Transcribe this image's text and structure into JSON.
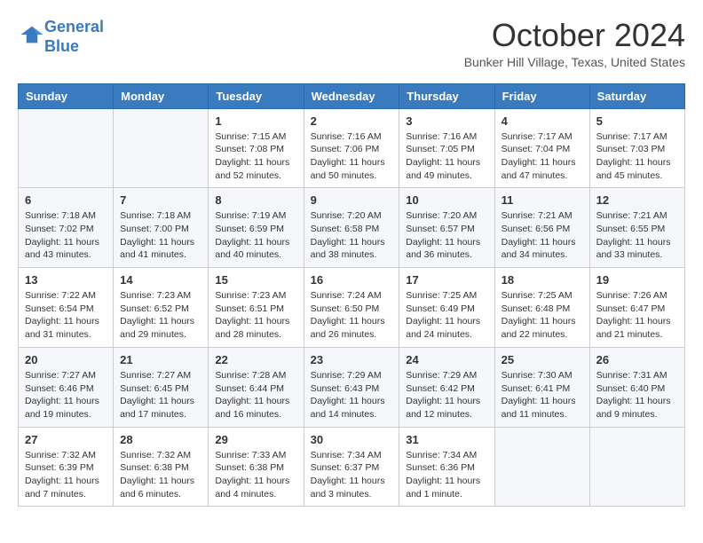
{
  "header": {
    "logo_line1": "General",
    "logo_line2": "Blue",
    "month_title": "October 2024",
    "location": "Bunker Hill Village, Texas, United States"
  },
  "weekdays": [
    "Sunday",
    "Monday",
    "Tuesday",
    "Wednesday",
    "Thursday",
    "Friday",
    "Saturday"
  ],
  "weeks": [
    [
      {
        "day": "",
        "info": ""
      },
      {
        "day": "",
        "info": ""
      },
      {
        "day": "1",
        "info": "Sunrise: 7:15 AM\nSunset: 7:08 PM\nDaylight: 11 hours and 52 minutes."
      },
      {
        "day": "2",
        "info": "Sunrise: 7:16 AM\nSunset: 7:06 PM\nDaylight: 11 hours and 50 minutes."
      },
      {
        "day": "3",
        "info": "Sunrise: 7:16 AM\nSunset: 7:05 PM\nDaylight: 11 hours and 49 minutes."
      },
      {
        "day": "4",
        "info": "Sunrise: 7:17 AM\nSunset: 7:04 PM\nDaylight: 11 hours and 47 minutes."
      },
      {
        "day": "5",
        "info": "Sunrise: 7:17 AM\nSunset: 7:03 PM\nDaylight: 11 hours and 45 minutes."
      }
    ],
    [
      {
        "day": "6",
        "info": "Sunrise: 7:18 AM\nSunset: 7:02 PM\nDaylight: 11 hours and 43 minutes."
      },
      {
        "day": "7",
        "info": "Sunrise: 7:18 AM\nSunset: 7:00 PM\nDaylight: 11 hours and 41 minutes."
      },
      {
        "day": "8",
        "info": "Sunrise: 7:19 AM\nSunset: 6:59 PM\nDaylight: 11 hours and 40 minutes."
      },
      {
        "day": "9",
        "info": "Sunrise: 7:20 AM\nSunset: 6:58 PM\nDaylight: 11 hours and 38 minutes."
      },
      {
        "day": "10",
        "info": "Sunrise: 7:20 AM\nSunset: 6:57 PM\nDaylight: 11 hours and 36 minutes."
      },
      {
        "day": "11",
        "info": "Sunrise: 7:21 AM\nSunset: 6:56 PM\nDaylight: 11 hours and 34 minutes."
      },
      {
        "day": "12",
        "info": "Sunrise: 7:21 AM\nSunset: 6:55 PM\nDaylight: 11 hours and 33 minutes."
      }
    ],
    [
      {
        "day": "13",
        "info": "Sunrise: 7:22 AM\nSunset: 6:54 PM\nDaylight: 11 hours and 31 minutes."
      },
      {
        "day": "14",
        "info": "Sunrise: 7:23 AM\nSunset: 6:52 PM\nDaylight: 11 hours and 29 minutes."
      },
      {
        "day": "15",
        "info": "Sunrise: 7:23 AM\nSunset: 6:51 PM\nDaylight: 11 hours and 28 minutes."
      },
      {
        "day": "16",
        "info": "Sunrise: 7:24 AM\nSunset: 6:50 PM\nDaylight: 11 hours and 26 minutes."
      },
      {
        "day": "17",
        "info": "Sunrise: 7:25 AM\nSunset: 6:49 PM\nDaylight: 11 hours and 24 minutes."
      },
      {
        "day": "18",
        "info": "Sunrise: 7:25 AM\nSunset: 6:48 PM\nDaylight: 11 hours and 22 minutes."
      },
      {
        "day": "19",
        "info": "Sunrise: 7:26 AM\nSunset: 6:47 PM\nDaylight: 11 hours and 21 minutes."
      }
    ],
    [
      {
        "day": "20",
        "info": "Sunrise: 7:27 AM\nSunset: 6:46 PM\nDaylight: 11 hours and 19 minutes."
      },
      {
        "day": "21",
        "info": "Sunrise: 7:27 AM\nSunset: 6:45 PM\nDaylight: 11 hours and 17 minutes."
      },
      {
        "day": "22",
        "info": "Sunrise: 7:28 AM\nSunset: 6:44 PM\nDaylight: 11 hours and 16 minutes."
      },
      {
        "day": "23",
        "info": "Sunrise: 7:29 AM\nSunset: 6:43 PM\nDaylight: 11 hours and 14 minutes."
      },
      {
        "day": "24",
        "info": "Sunrise: 7:29 AM\nSunset: 6:42 PM\nDaylight: 11 hours and 12 minutes."
      },
      {
        "day": "25",
        "info": "Sunrise: 7:30 AM\nSunset: 6:41 PM\nDaylight: 11 hours and 11 minutes."
      },
      {
        "day": "26",
        "info": "Sunrise: 7:31 AM\nSunset: 6:40 PM\nDaylight: 11 hours and 9 minutes."
      }
    ],
    [
      {
        "day": "27",
        "info": "Sunrise: 7:32 AM\nSunset: 6:39 PM\nDaylight: 11 hours and 7 minutes."
      },
      {
        "day": "28",
        "info": "Sunrise: 7:32 AM\nSunset: 6:38 PM\nDaylight: 11 hours and 6 minutes."
      },
      {
        "day": "29",
        "info": "Sunrise: 7:33 AM\nSunset: 6:38 PM\nDaylight: 11 hours and 4 minutes."
      },
      {
        "day": "30",
        "info": "Sunrise: 7:34 AM\nSunset: 6:37 PM\nDaylight: 11 hours and 3 minutes."
      },
      {
        "day": "31",
        "info": "Sunrise: 7:34 AM\nSunset: 6:36 PM\nDaylight: 11 hours and 1 minute."
      },
      {
        "day": "",
        "info": ""
      },
      {
        "day": "",
        "info": ""
      }
    ]
  ]
}
